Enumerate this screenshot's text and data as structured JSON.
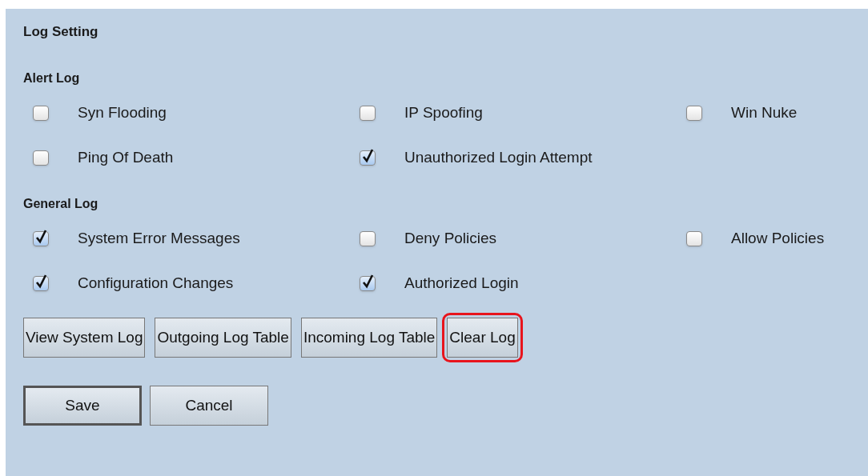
{
  "title": "Log Setting",
  "sections": [
    {
      "heading": "Alert Log",
      "rows": [
        [
          {
            "label": "Syn Flooding",
            "checked": false
          },
          {
            "label": "IP Spoofing",
            "checked": false
          },
          {
            "label": "Win Nuke",
            "checked": false
          }
        ],
        [
          {
            "label": "Ping Of Death",
            "checked": false
          },
          {
            "label": "Unauthorized Login Attempt",
            "checked": true
          }
        ]
      ]
    },
    {
      "heading": "General Log",
      "rows": [
        [
          {
            "label": "System Error Messages",
            "checked": true
          },
          {
            "label": "Deny Policies",
            "checked": false
          },
          {
            "label": "Allow Policies",
            "checked": false
          }
        ],
        [
          {
            "label": "Configuration Changes",
            "checked": true
          },
          {
            "label": "Authorized Login",
            "checked": true
          }
        ]
      ]
    }
  ],
  "log_buttons": [
    {
      "label": "View System Log",
      "highlighted": false
    },
    {
      "label": "Outgoing Log Table",
      "highlighted": false
    },
    {
      "label": "Incoming Log Table",
      "highlighted": false
    },
    {
      "label": "Clear Log",
      "highlighted": true
    }
  ],
  "form_buttons": [
    {
      "label": "Save",
      "default": true
    },
    {
      "label": "Cancel",
      "default": false
    }
  ]
}
